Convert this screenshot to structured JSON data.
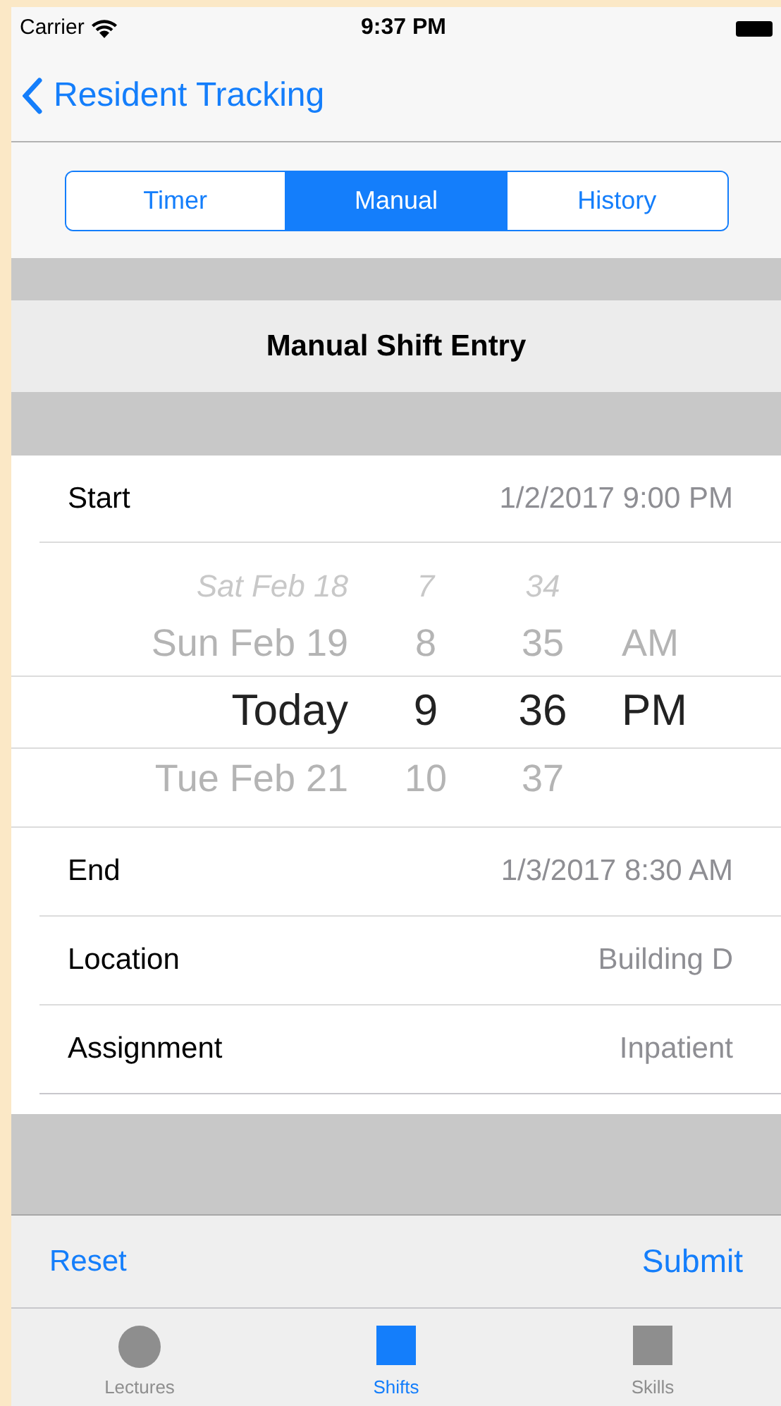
{
  "status_bar": {
    "carrier": "Carrier",
    "time": "9:37 PM"
  },
  "nav": {
    "back_label": "Resident Tracking"
  },
  "segments": [
    {
      "label": "Timer",
      "selected": false
    },
    {
      "label": "Manual",
      "selected": true
    },
    {
      "label": "History",
      "selected": false
    }
  ],
  "section_title": "Manual Shift Entry",
  "start": {
    "label": "Start",
    "value": "1/2/2017 9:00 PM"
  },
  "picker": {
    "rows": [
      {
        "date": "Sat Feb 18",
        "hour": "7",
        "minute": "34",
        "selected": false
      },
      {
        "date": "Sun Feb 19",
        "hour": "8",
        "minute": "35",
        "period": "AM",
        "selected": false
      },
      {
        "date": "Today",
        "hour": "9",
        "minute": "36",
        "period": "PM",
        "selected": true
      },
      {
        "date": "Tue Feb 21",
        "hour": "10",
        "minute": "37",
        "selected": false
      }
    ]
  },
  "fields": [
    {
      "label": "End",
      "value": "1/3/2017 8:30 AM"
    },
    {
      "label": "Location",
      "value": "Building D"
    },
    {
      "label": "Assignment",
      "value": "Inpatient"
    }
  ],
  "toolbar": {
    "left": "Reset",
    "right": "Submit"
  },
  "tab_bar": [
    {
      "label": "Lectures",
      "kind": "circle",
      "selected": false
    },
    {
      "label": "Shifts",
      "kind": "square",
      "selected": true
    },
    {
      "label": "Skills",
      "kind": "square",
      "selected": false
    }
  ]
}
